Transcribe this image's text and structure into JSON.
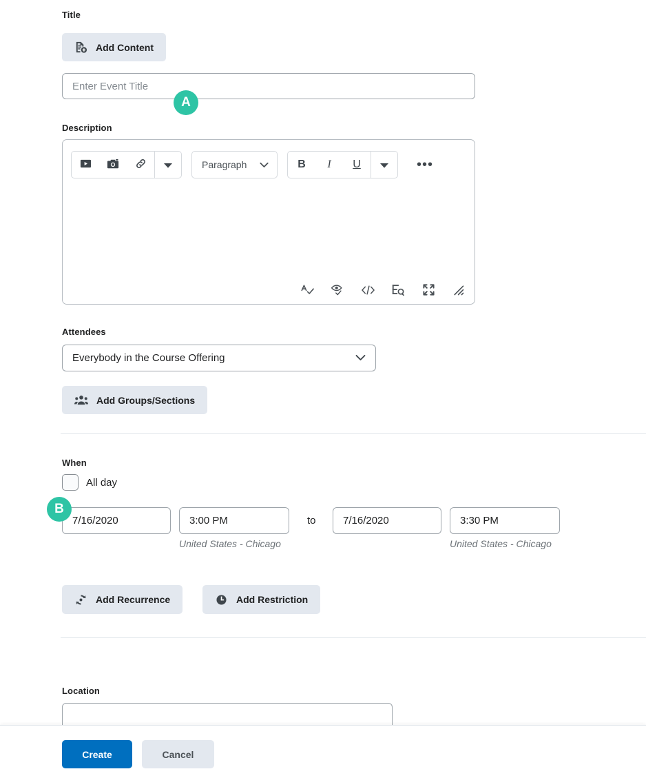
{
  "title_section": {
    "label": "Title",
    "add_content_button": "Add Content",
    "add_content_icon": "document-plus-icon",
    "title_input_placeholder": "Enter Event Title",
    "title_input_value": ""
  },
  "description_section": {
    "label": "Description",
    "toolbar": {
      "insert_media_icon": "play-media-icon",
      "insert_image_icon": "camera-image-icon",
      "insert_link_icon": "link-icon",
      "insert_more_caret_icon": "caret-down-icon",
      "format_select_value": "Paragraph",
      "format_select_caret_icon": "chevron-down-icon",
      "bold_label": "B",
      "italic_label": "I",
      "underline_label": "U",
      "style_more_caret_icon": "caret-down-icon",
      "overflow_label": "•••",
      "overflow_icon": "ellipsis-icon"
    },
    "body_value": "",
    "status_icons": [
      "spellcheck-icon",
      "accessibility-check-icon",
      "html-source-icon",
      "word-count-icon",
      "fullscreen-icon",
      "resize-handle-icon"
    ]
  },
  "attendees_section": {
    "label": "Attendees",
    "select_value": "Everybody in the Course Offering",
    "select_caret_icon": "chevron-down-icon",
    "add_groups_button": "Add Groups/Sections",
    "add_groups_icon": "people-group-icon"
  },
  "when_section": {
    "label": "When",
    "all_day_label": "All day",
    "all_day_checked": false,
    "start_date": "7/16/2020",
    "start_time": "3:00 PM",
    "start_timezone": "United States - Chicago",
    "separator": "to",
    "end_date": "7/16/2020",
    "end_time": "3:30 PM",
    "end_timezone": "United States - Chicago",
    "add_recurrence_button": "Add Recurrence",
    "add_recurrence_icon": "repeat-icon",
    "add_restriction_button": "Add Restriction",
    "add_restriction_icon": "clock-icon"
  },
  "location_section": {
    "label": "Location",
    "input_value": "",
    "input_placeholder": ""
  },
  "footer": {
    "create_button": "Create",
    "cancel_button": "Cancel"
  },
  "markers": [
    {
      "letter": "A",
      "target": "title-input"
    },
    {
      "letter": "B",
      "target": "start-date-input"
    }
  ],
  "colors": {
    "marker": "#2ec4a5",
    "primary_button": "#006fbf",
    "soft_button": "#e3e8ef",
    "divider": "#e2e7eb",
    "input_border": "#9ea5ab"
  }
}
